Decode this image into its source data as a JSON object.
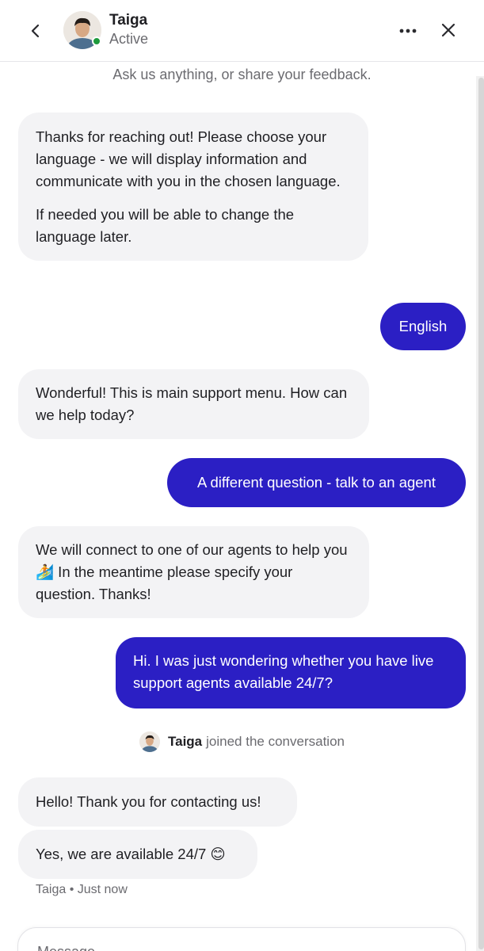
{
  "header": {
    "agent_name": "Taiga",
    "status": "Active"
  },
  "conversation": {
    "subtitle": "Ask us anything, or share your feedback.",
    "messages": [
      {
        "from": "bot",
        "paragraphs": [
          "Thanks for reaching out! Please choose your language - we will display information and communicate with you in the chosen language.",
          "If needed you will be able to change the language later."
        ]
      },
      {
        "from": "user",
        "text": "English"
      },
      {
        "from": "bot",
        "text": "Wonderful! This is main support menu. How can we help today?"
      },
      {
        "from": "user",
        "text": "A different question - talk to an agent"
      },
      {
        "from": "bot",
        "text_before": "We will connect to one of our agents to help you",
        "emoji": "🏄",
        "text_after": " In the meantime please specify your question. Thanks!"
      },
      {
        "from": "user",
        "text": "Hi. I was just wondering whether you have live support agents available 24/7?"
      }
    ],
    "joined": {
      "name": "Taiga",
      "text": "joined the conversation"
    },
    "agent_messages": [
      {
        "text": "Hello! Thank you for contacting us!"
      },
      {
        "text": "Yes, we are available 24/7 😊"
      }
    ],
    "meta": "Taiga • Just now"
  },
  "composer": {
    "placeholder": "Message…"
  },
  "colors": {
    "accent": "#2b1fc4",
    "bot_bubble": "#f3f3f5",
    "online": "#1e9a3c"
  },
  "icons": [
    "back-chevron-icon",
    "more-dots-icon",
    "close-icon"
  ]
}
